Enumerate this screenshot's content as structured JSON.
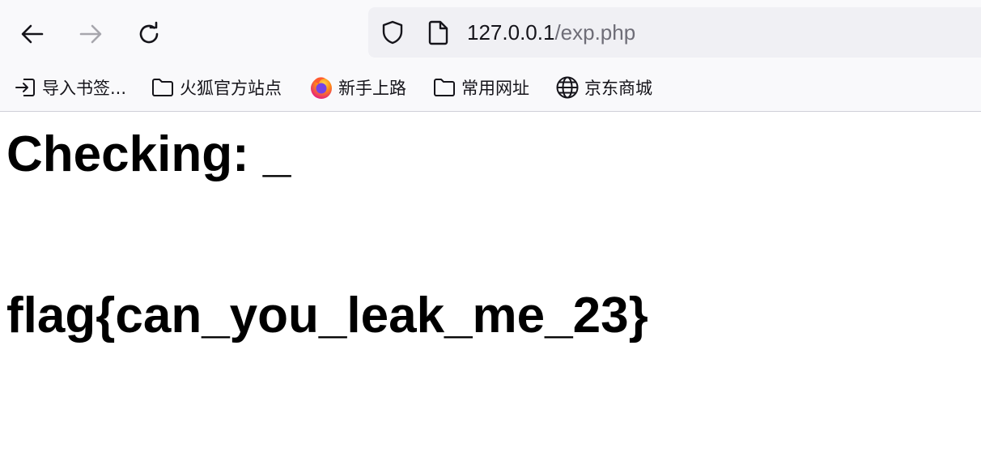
{
  "toolbar": {
    "back_icon": "arrow-left-icon",
    "forward_icon": "arrow-right-icon",
    "reload_icon": "reload-icon"
  },
  "urlbar": {
    "shield_icon": "shield-icon",
    "page_icon": "page-icon",
    "host": "127.0.0.1",
    "path": "/exp.php"
  },
  "bookmarks": [
    {
      "label": "导入书签...",
      "icon": "import-icon"
    },
    {
      "label": "火狐官方站点",
      "icon": "folder-icon"
    },
    {
      "label": "新手上路",
      "icon": "firefox-icon"
    },
    {
      "label": "常用网址",
      "icon": "folder-icon"
    },
    {
      "label": "京东商城",
      "icon": "globe-icon"
    }
  ],
  "page": {
    "checking": "Checking: _",
    "flag": "flag{can_you_leak_me_23}"
  },
  "colors": {
    "chrome_bg": "#f9f9fb",
    "urlbar_bg": "#f0f0f4",
    "text": "#15141a",
    "muted": "#6e6d77"
  }
}
